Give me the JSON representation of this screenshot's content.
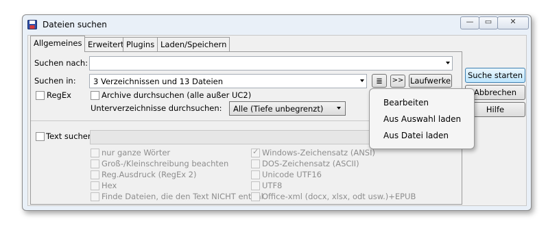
{
  "window": {
    "title": "Dateien suchen",
    "controls": {
      "minimize": "—",
      "restore": "▭",
      "close": "✕"
    }
  },
  "tabs": [
    {
      "label": "Allgemeines",
      "active": true
    },
    {
      "label": "Erweitert"
    },
    {
      "label": "Plugins"
    },
    {
      "label": "Laden/Speichern"
    }
  ],
  "form": {
    "search_for_label": "Suchen nach:",
    "search_for_value": "",
    "search_in_label": "Suchen in:",
    "search_in_value": "3 Verzeichnissen und 13 Dateien",
    "browse_button": "≣",
    "arrow_button": ">>",
    "drives_button": "Laufwerke",
    "regex_label": "RegEx",
    "archive_label": "Archive durchsuchen (alle außer UC2)",
    "subdirs_label": "Unterverzeichnisse durchsuchen:",
    "subdirs_value": "Alle (Tiefe unbegrenzt)",
    "text_search_label": "Text suchen"
  },
  "text_options": {
    "left": [
      "nur ganze Wörter",
      "Groß-/Kleinschreibung beachten",
      "Reg.Ausdruck (RegEx 2)",
      "Hex",
      "Finde Dateien, die den Text NICHT enthal"
    ],
    "right": [
      "Windows-Zeichensatz (ANSI)",
      "DOS-Zeichensatz (ASCII)",
      "Unicode UTF16",
      "UTF8",
      "Office-xml (docx, xlsx, odt usw.)+EPUB"
    ]
  },
  "actions": {
    "start": "Suche starten",
    "cancel": "Abbrechen",
    "help": "Hilfe"
  },
  "context_menu": {
    "items": [
      "Bearbeiten",
      "Aus Auswahl laden",
      "Aus Datei laden"
    ]
  },
  "colors": {
    "accent": "#3c7fb1",
    "disabled": "#8d8d8d"
  }
}
